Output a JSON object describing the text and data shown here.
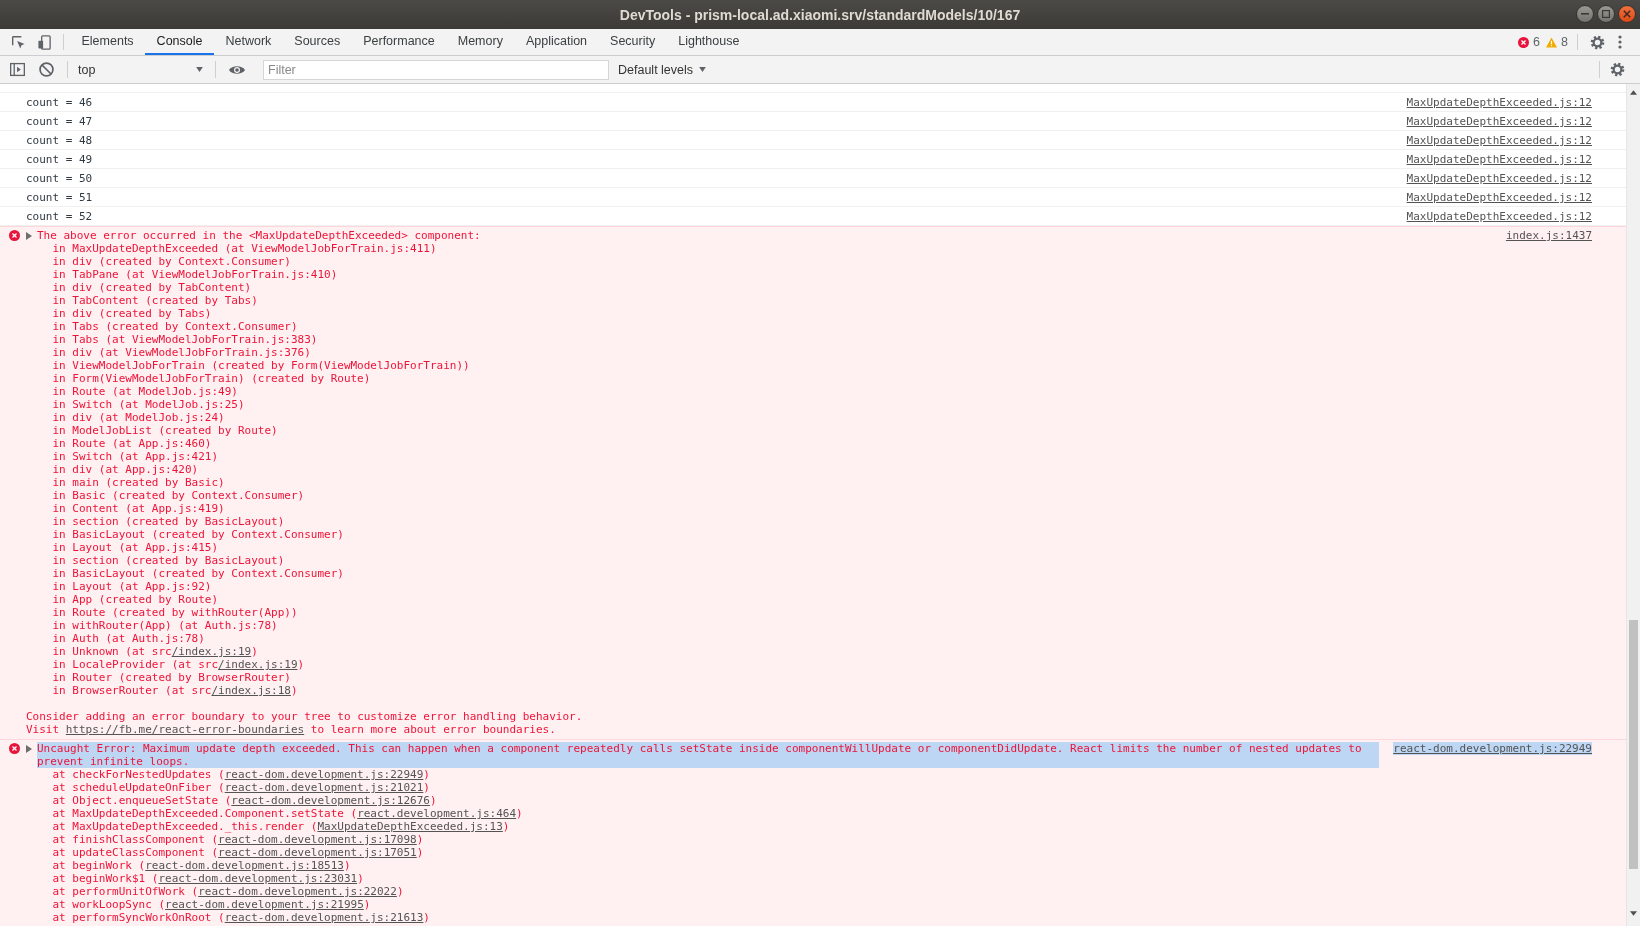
{
  "window": {
    "title": "DevTools - prism-local.ad.xiaomi.srv/standardModels/10/167"
  },
  "tabs": [
    {
      "label": "Elements",
      "selected": false
    },
    {
      "label": "Console",
      "selected": true
    },
    {
      "label": "Network",
      "selected": false
    },
    {
      "label": "Sources",
      "selected": false
    },
    {
      "label": "Performance",
      "selected": false
    },
    {
      "label": "Memory",
      "selected": false
    },
    {
      "label": "Application",
      "selected": false
    },
    {
      "label": "Security",
      "selected": false
    },
    {
      "label": "Lighthouse",
      "selected": false
    }
  ],
  "issue_counters": [
    {
      "kind": "error",
      "count": "6"
    },
    {
      "kind": "warning",
      "count": "8"
    }
  ],
  "console_toolbar": {
    "context": "top",
    "filter": {
      "placeholder": "Filter"
    },
    "log_levels": "Default levels"
  },
  "messages": [
    {
      "kind": "log",
      "text": "count = 46",
      "source": "MaxUpdateDepthExceeded.js:12",
      "text_selected": false
    },
    {
      "kind": "log",
      "text": "count = 47",
      "source": "MaxUpdateDepthExceeded.js:12",
      "text_selected": false
    },
    {
      "kind": "log",
      "text": "count = 48",
      "source": "MaxUpdateDepthExceeded.js:12",
      "text_selected": false
    },
    {
      "kind": "log",
      "text": "count = 49",
      "source": "MaxUpdateDepthExceeded.js:12",
      "text_selected": false
    },
    {
      "kind": "log",
      "text": "count = 50",
      "source": "MaxUpdateDepthExceeded.js:12",
      "text_selected": false
    },
    {
      "kind": "log",
      "text": "count = 51",
      "source": "MaxUpdateDepthExceeded.js:12",
      "text_selected": false
    },
    {
      "kind": "log",
      "text": "count = 52",
      "source": "MaxUpdateDepthExceeded.js:12",
      "text_selected": false
    },
    {
      "kind": "error",
      "expanded": false,
      "text": "The above error occurred in the <MaxUpdateDepthExceeded> component:",
      "text_selected": false,
      "source": "index.js:1437",
      "stack": [
        {
          "text": "in MaxUpdateDepthExceeded (at ViewModelJobForTrain.js:411)"
        },
        {
          "text": "in div (created by Context.Consumer)"
        },
        {
          "text": "in TabPane (at ViewModelJobForTrain.js:410)"
        },
        {
          "text": "in div (created by TabContent)"
        },
        {
          "text": "in TabContent (created by Tabs)"
        },
        {
          "text": "in div (created by Tabs)"
        },
        {
          "text": "in Tabs (created by Context.Consumer)"
        },
        {
          "text": "in Tabs (at ViewModelJobForTrain.js:383)"
        },
        {
          "text": "in div (at ViewModelJobForTrain.js:376)"
        },
        {
          "text": "in ViewModelJobForTrain (created by Form(ViewModelJobForTrain))"
        },
        {
          "text": "in Form(ViewModelJobForTrain) (created by Route)"
        },
        {
          "text": "in Route (at ModelJob.js:49)"
        },
        {
          "text": "in Switch (at ModelJob.js:25)"
        },
        {
          "text": "in div (at ModelJob.js:24)"
        },
        {
          "text": "in ModelJobList (created by Route)"
        },
        {
          "text": "in Route (at App.js:460)"
        },
        {
          "text": "in Switch (at App.js:421)"
        },
        {
          "text": "in div (at App.js:420)"
        },
        {
          "text": "in main (created by Basic)"
        },
        {
          "text": "in Basic (created by Context.Consumer)"
        },
        {
          "text": "in Content (at App.js:419)"
        },
        {
          "text": "in section (created by BasicLayout)"
        },
        {
          "text": "in BasicLayout (created by Context.Consumer)"
        },
        {
          "text": "in Layout (at App.js:415)"
        },
        {
          "text": "in section (created by BasicLayout)"
        },
        {
          "text": "in BasicLayout (created by Context.Consumer)"
        },
        {
          "text": "in Layout (at App.js:92)"
        },
        {
          "text": "in App (created by Route)"
        },
        {
          "text": "in Route (created by withRouter(App))"
        },
        {
          "text": "in withRouter(App) (at Auth.js:78)"
        },
        {
          "text": "in Auth (at Auth.js:78)"
        },
        {
          "text": "in Unknown (at src",
          "link": "/index.js:19",
          "after": ")"
        },
        {
          "text": "in LocaleProvider (at src",
          "link": "/index.js:19",
          "after": ")"
        },
        {
          "text": "in Router (created by BrowserRouter)"
        },
        {
          "text": "in BrowserRouter (at src",
          "link": "/index.js:18",
          "after": ")"
        }
      ],
      "notes": [
        {
          "text": "Consider adding an error boundary to your tree to customize error handling behavior."
        },
        {
          "text": "Visit ",
          "link": "https://fb.me/react-error-boundaries",
          "after": " to learn more about error boundaries."
        }
      ]
    },
    {
      "kind": "error",
      "expanded": false,
      "text": "Uncaught Error: Maximum update depth exceeded. This can happen when a component repeatedly calls setState inside componentWillUpdate or componentDidUpdate. React limits the number of nested updates to prevent infinite loops.",
      "text_selected": true,
      "source": "react-dom.development.js:22949",
      "stack": [
        {
          "text": "at checkForNestedUpdates (",
          "link": "react-dom.development.js:22949",
          "after": ")"
        },
        {
          "text": "at scheduleUpdateOnFiber (",
          "link": "react-dom.development.js:21021",
          "after": ")"
        },
        {
          "text": "at Object.enqueueSetState (",
          "link": "react-dom.development.js:12676",
          "after": ")"
        },
        {
          "text": "at MaxUpdateDepthExceeded.Component.setState (",
          "link": "react.development.js:464",
          "after": ")"
        },
        {
          "text": "at MaxUpdateDepthExceeded._this.render (",
          "link": "MaxUpdateDepthExceeded.js:13",
          "after": ")"
        },
        {
          "text": "at finishClassComponent (",
          "link": "react-dom.development.js:17098",
          "after": ")"
        },
        {
          "text": "at updateClassComponent (",
          "link": "react-dom.development.js:17051",
          "after": ")"
        },
        {
          "text": "at beginWork (",
          "link": "react-dom.development.js:18513",
          "after": ")"
        },
        {
          "text": "at beginWork$1 (",
          "link": "react-dom.development.js:23031",
          "after": ")"
        },
        {
          "text": "at performUnitOfWork (",
          "link": "react-dom.development.js:22022",
          "after": ")"
        },
        {
          "text": "at workLoopSync (",
          "link": "react-dom.development.js:21995",
          "after": ")"
        },
        {
          "text": "at performSyncWorkOnRoot (",
          "link": "react-dom.development.js:21613",
          "after": ")"
        }
      ]
    }
  ]
}
